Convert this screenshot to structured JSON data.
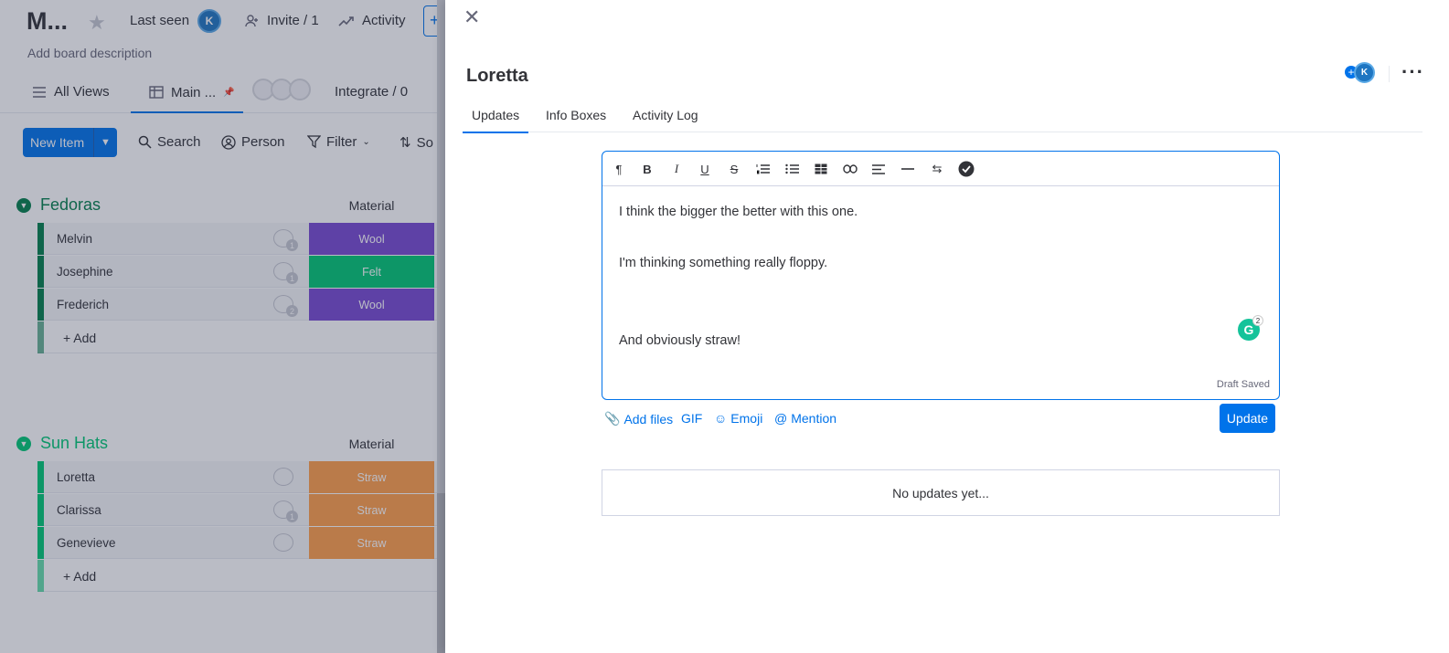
{
  "board": {
    "title": "M...",
    "last_seen_label": "Last seen",
    "avatar_initial": "K",
    "invite_label": "Invite / 1",
    "activity_label": "Activity",
    "add_label": "+",
    "description": "Add board description",
    "views": {
      "all_views": "All Views",
      "main_table": "Main ...",
      "integrate": "Integrate / 0"
    },
    "toolbar": {
      "new_item": "New Item",
      "search": "Search",
      "person": "Person",
      "filter": "Filter",
      "sort": "So"
    },
    "groups": [
      {
        "name": "Fedoras",
        "color": "#037f4c",
        "column_header": "Material",
        "rows": [
          {
            "name": "Melvin",
            "updates": "1",
            "material": "Wool",
            "material_color": "#784bd1"
          },
          {
            "name": "Josephine",
            "updates": "1",
            "material": "Felt",
            "material_color": "#00c875"
          },
          {
            "name": "Frederich",
            "updates": "2",
            "material": "Wool",
            "material_color": "#784bd1"
          }
        ],
        "add_label": "+ Add"
      },
      {
        "name": "Sun Hats",
        "color": "#00c875",
        "column_header": "Material",
        "rows": [
          {
            "name": "Loretta",
            "updates": "",
            "material": "Straw",
            "material_color": "#ff9f4a"
          },
          {
            "name": "Clarissa",
            "updates": "1",
            "material": "Straw",
            "material_color": "#ff9f4a"
          },
          {
            "name": "Genevieve",
            "updates": "",
            "material": "Straw",
            "material_color": "#ff9f4a"
          }
        ],
        "add_label": "+ Add"
      }
    ]
  },
  "panel": {
    "item_title": "Loretta",
    "subscriber_initial": "K",
    "tabs": [
      "Updates",
      "Info Boxes",
      "Activity Log"
    ],
    "editor": {
      "tools": [
        "paragraph-icon",
        "bold-icon",
        "italic-icon",
        "underline-icon",
        "strikethrough-icon",
        "numbered-list-icon",
        "bullet-list-icon",
        "table-icon",
        "link-icon",
        "align-icon",
        "divider-icon",
        "direction-icon",
        "checklist-icon"
      ],
      "lines": [
        "I think the bigger the better with this one.",
        "I'm thinking something really floppy.",
        "And obviously straw!"
      ],
      "grammarly_count": "2",
      "draft_status": "Draft Saved"
    },
    "actions": {
      "add_files": "Add files",
      "gif": "GIF",
      "emoji": "Emoji",
      "mention": "Mention",
      "update": "Update"
    },
    "empty_state": "No updates yet..."
  },
  "colors": {
    "accent": "#0073ea",
    "overlay": "rgba(41,47,76,0.32)"
  }
}
